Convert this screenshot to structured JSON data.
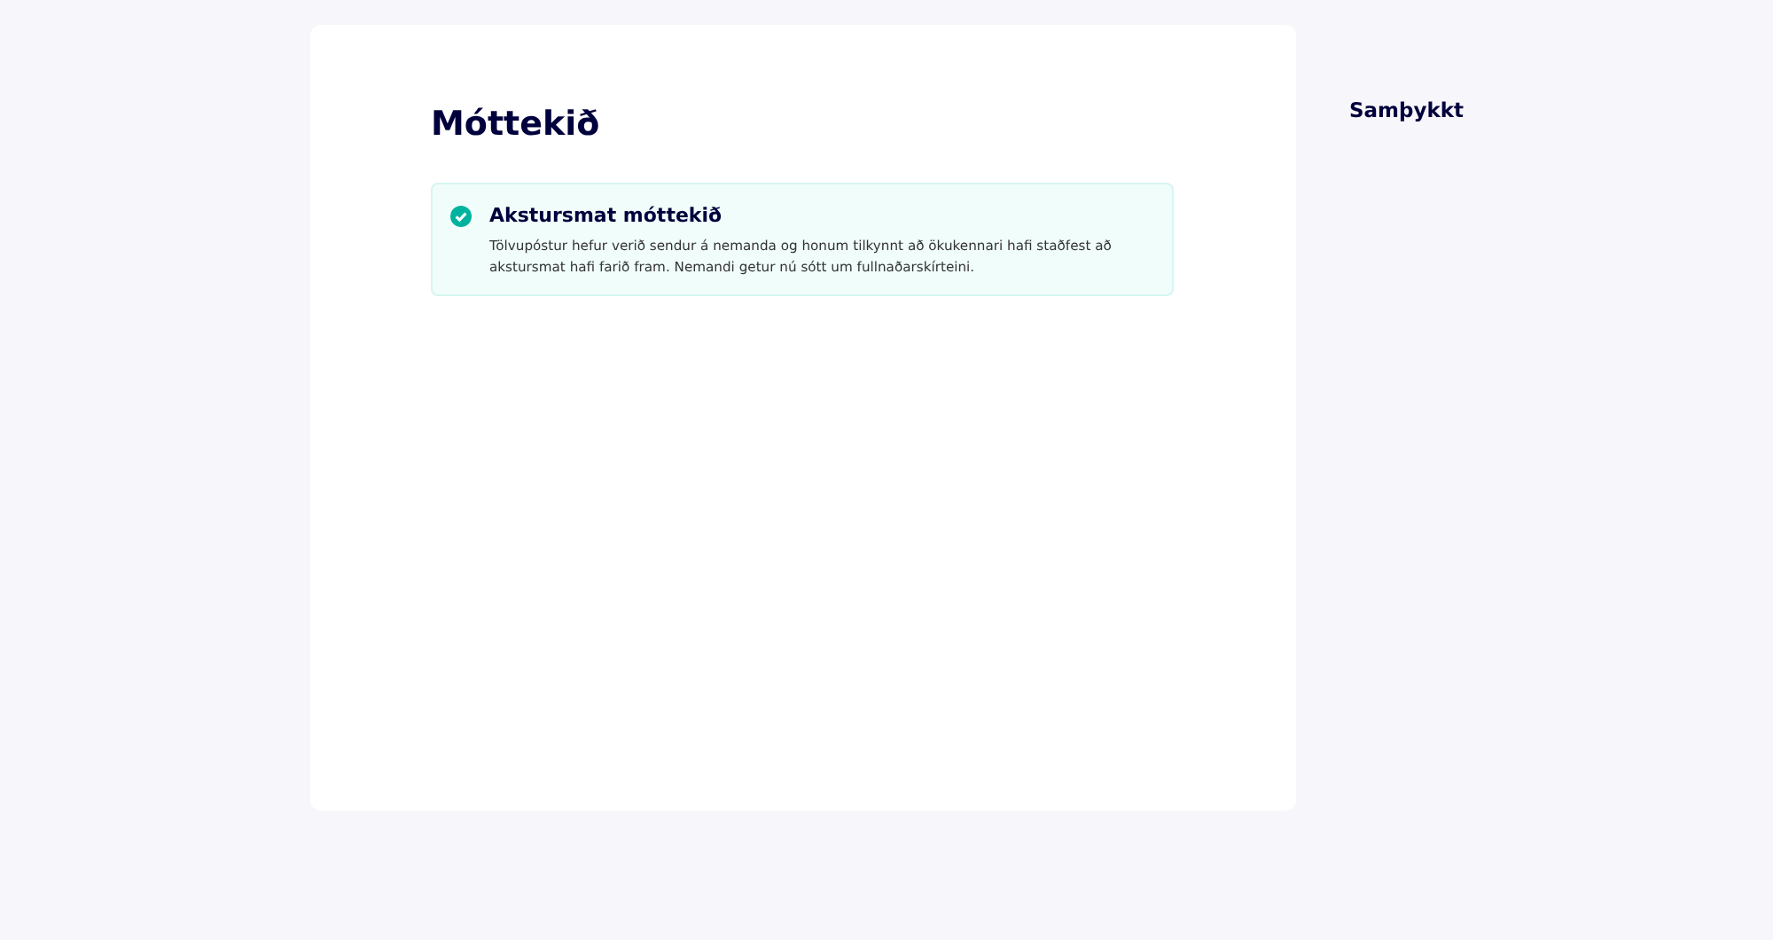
{
  "main": {
    "title": "Móttekið",
    "alert": {
      "kind": "success",
      "title": "Akstursmat móttekið",
      "message": "Tölvupóstur hefur verið sendur á nemanda og honum tilkynnt að ökukennari hafi staðfest að akstursmat hafi farið fram. Nemandi getur nú sótt um fullnaðarskírteini."
    }
  },
  "sidebar": {
    "step": "Samþykkt"
  }
}
